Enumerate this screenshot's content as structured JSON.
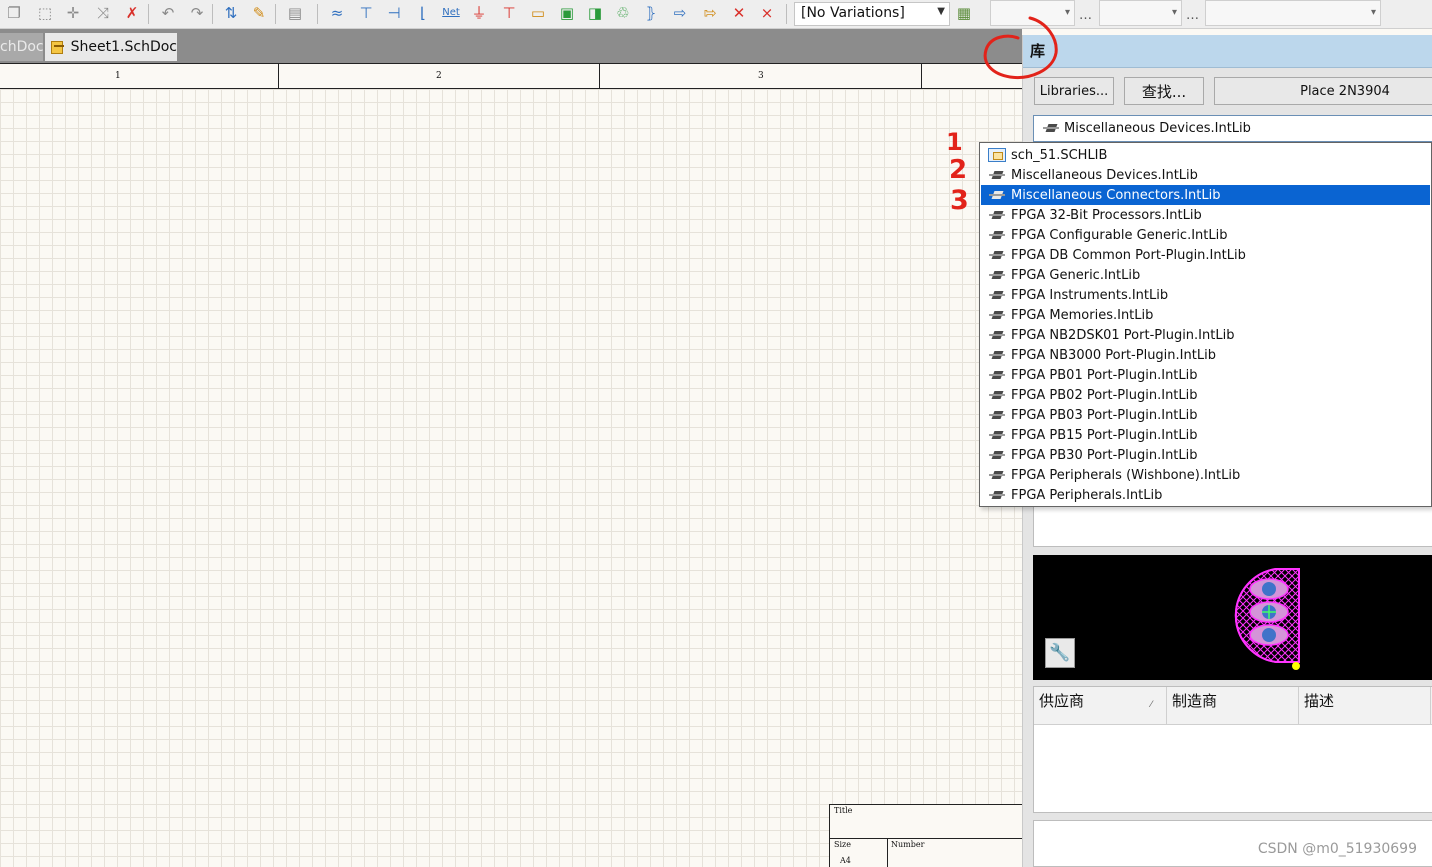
{
  "toolbar": {
    "variations_label": "[No Variations]",
    "icons": [
      {
        "name": "copy-icon",
        "glyph": "❐",
        "color": "grey"
      },
      {
        "name": "select-rect-icon",
        "glyph": "⬚",
        "color": "grey"
      },
      {
        "name": "move-icon",
        "glyph": "✛",
        "color": "grey"
      },
      {
        "name": "cross-probe-icon",
        "glyph": "⤨",
        "color": "grey"
      },
      {
        "name": "clear-filter-icon",
        "glyph": "✗",
        "color": "red"
      },
      {
        "name": "undo-icon",
        "glyph": "↶",
        "color": "grey"
      },
      {
        "name": "redo-icon",
        "glyph": "↷",
        "color": "grey"
      },
      {
        "name": "up-down-hierarchy-icon",
        "glyph": "⇅",
        "color": "blue"
      },
      {
        "name": "cross-probe-pen-icon",
        "glyph": "✎",
        "color": "orange"
      },
      {
        "name": "browse-library-icon",
        "glyph": "▤",
        "color": "grey"
      },
      {
        "name": "place-wire-icon",
        "glyph": "≈",
        "color": "blue"
      },
      {
        "name": "place-bus-icon",
        "glyph": "⊤",
        "color": "blue"
      },
      {
        "name": "place-signal-harness-icon",
        "glyph": "⊣",
        "color": "blue"
      },
      {
        "name": "place-bus-entry-icon",
        "glyph": "⌊",
        "color": "blue"
      },
      {
        "name": "place-net-label-icon",
        "glyph": "Net",
        "color": "blue"
      },
      {
        "name": "gnd-port-icon",
        "glyph": "⏚",
        "color": "red"
      },
      {
        "name": "vcc-port-icon",
        "glyph": "⊤",
        "color": "red"
      },
      {
        "name": "place-part-icon",
        "glyph": "▭",
        "color": "orange"
      },
      {
        "name": "sheet-symbol-icon",
        "glyph": "▣",
        "color": "green"
      },
      {
        "name": "sheet-entry-icon",
        "glyph": "◨",
        "color": "green"
      },
      {
        "name": "device-sheet-icon",
        "glyph": "♲",
        "color": "green"
      },
      {
        "name": "harness-connector-icon",
        "glyph": "⦄",
        "color": "blue"
      },
      {
        "name": "harness-entry-icon",
        "glyph": "⇨",
        "color": "blue"
      },
      {
        "name": "port-icon",
        "glyph": "⇰",
        "color": "orange"
      },
      {
        "name": "no-erc-icon",
        "glyph": "✕",
        "color": "red"
      },
      {
        "name": "compile-mask-icon",
        "glyph": "⨯",
        "color": "red"
      }
    ]
  },
  "tabs": {
    "inactive": "chDoc",
    "active": "Sheet1.SchDoc"
  },
  "sheet": {
    "ruler": [
      "1",
      "2",
      "3"
    ],
    "title_label": "Title",
    "size_label": "Size",
    "number_label": "Number",
    "size_value": "A4"
  },
  "annotations": {
    "steps": [
      "1",
      "2",
      "3"
    ]
  },
  "panel": {
    "title": "库",
    "buttons": {
      "libraries": "Libraries...",
      "search": "查找...",
      "place": "Place 2N3904"
    },
    "current_library": "Miscellaneous Devices.IntLib",
    "grid_columns": [
      "供应商",
      "制造商",
      "描述"
    ],
    "watermark": "CSDN @m0_51930699"
  },
  "dropdown": {
    "selected_index": 2,
    "items": [
      {
        "label": "sch_51.SCHLIB",
        "icon": "schlib-icon"
      },
      {
        "label": "Miscellaneous Devices.IntLib",
        "icon": "integrated-library-icon"
      },
      {
        "label": "Miscellaneous Connectors.IntLib",
        "icon": "integrated-library-icon"
      },
      {
        "label": "FPGA 32-Bit Processors.IntLib",
        "icon": "integrated-library-icon"
      },
      {
        "label": "FPGA Configurable Generic.IntLib",
        "icon": "integrated-library-icon"
      },
      {
        "label": "FPGA DB Common Port-Plugin.IntLib",
        "icon": "integrated-library-icon"
      },
      {
        "label": "FPGA Generic.IntLib",
        "icon": "integrated-library-icon"
      },
      {
        "label": "FPGA Instruments.IntLib",
        "icon": "integrated-library-icon"
      },
      {
        "label": "FPGA Memories.IntLib",
        "icon": "integrated-library-icon"
      },
      {
        "label": "FPGA NB2DSK01 Port-Plugin.IntLib",
        "icon": "integrated-library-icon"
      },
      {
        "label": "FPGA NB3000 Port-Plugin.IntLib",
        "icon": "integrated-library-icon"
      },
      {
        "label": "FPGA PB01 Port-Plugin.IntLib",
        "icon": "integrated-library-icon"
      },
      {
        "label": "FPGA PB02 Port-Plugin.IntLib",
        "icon": "integrated-library-icon"
      },
      {
        "label": "FPGA PB03 Port-Plugin.IntLib",
        "icon": "integrated-library-icon"
      },
      {
        "label": "FPGA PB15 Port-Plugin.IntLib",
        "icon": "integrated-library-icon"
      },
      {
        "label": "FPGA PB30 Port-Plugin.IntLib",
        "icon": "integrated-library-icon"
      },
      {
        "label": "FPGA Peripherals (Wishbone).IntLib",
        "icon": "integrated-library-icon"
      },
      {
        "label": "FPGA Peripherals.IntLib",
        "icon": "integrated-library-icon"
      }
    ]
  },
  "colors": {
    "selection": "#0a64d2",
    "panel_header": "#bcd7ec",
    "annotation": "#e2231a",
    "footprint_outline": "#ff33ff"
  }
}
